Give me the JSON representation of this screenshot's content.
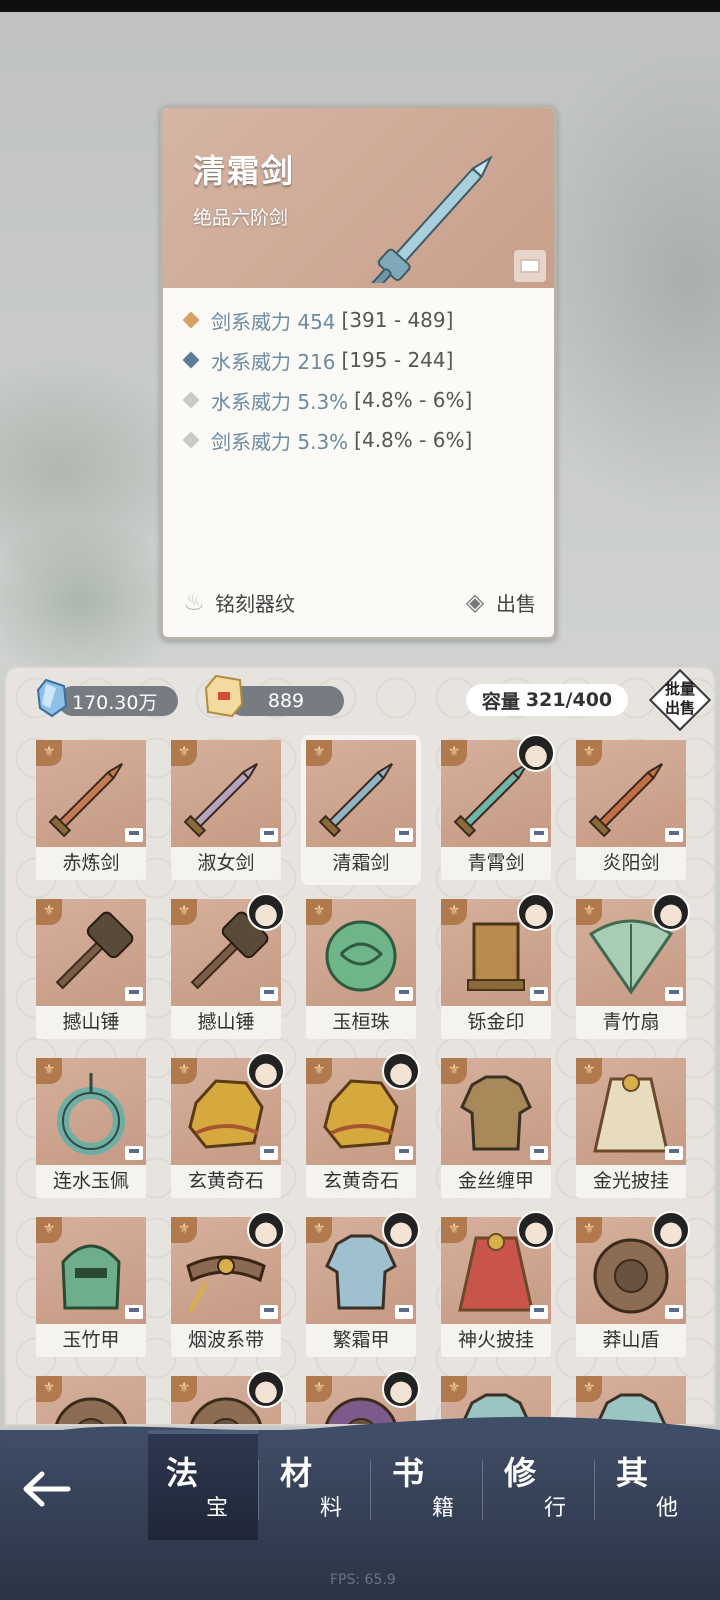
{
  "detail": {
    "name": "清霜剑",
    "grade": "绝品六阶剑",
    "stats": [
      {
        "label": "剑系威力 454",
        "range": "[391 - 489]",
        "diamond_color": "#d9a066"
      },
      {
        "label": "水系威力 216",
        "range": "[195 - 244]",
        "diamond_color": "#5f7d9c"
      },
      {
        "label": "水系威力 5.3%",
        "range": "[4.8% - 6%]",
        "diamond_color": "#c9c9c9"
      },
      {
        "label": "剑系威力 5.3%",
        "range": "[4.8% - 6%]",
        "diamond_color": "#c9c9c9"
      }
    ],
    "engrave_label": "铭刻器纹",
    "sell_label": "出售"
  },
  "bag": {
    "spirit_stones": "170.30万",
    "gold": "889",
    "capacity_label": "容量",
    "capacity_value": "321/400",
    "batch_sell_line1": "批量",
    "batch_sell_line2": "出售",
    "items": [
      {
        "name": "赤炼剑",
        "kind": "sword",
        "color": "#c77b52",
        "avatar": false
      },
      {
        "name": "淑女剑",
        "kind": "sword",
        "color": "#b8a4c0",
        "avatar": false
      },
      {
        "name": "清霜剑",
        "kind": "sword",
        "color": "#8fb6c7",
        "avatar": false,
        "selected": true
      },
      {
        "name": "青霄剑",
        "kind": "sword",
        "color": "#6fb5a8",
        "avatar": true
      },
      {
        "name": "炎阳剑",
        "kind": "sword",
        "color": "#c56f45",
        "avatar": false
      },
      {
        "name": "撼山锤",
        "kind": "hammer",
        "color": "#7a5d44",
        "avatar": false
      },
      {
        "name": "撼山锤",
        "kind": "hammer",
        "color": "#7a5d44",
        "avatar": true
      },
      {
        "name": "玉桓珠",
        "kind": "orb",
        "color": "#6fb58a",
        "avatar": false
      },
      {
        "name": "铄金印",
        "kind": "seal",
        "color": "#b98a4d",
        "avatar": true
      },
      {
        "name": "青竹扇",
        "kind": "fan",
        "color": "#a8cdb4",
        "avatar": true
      },
      {
        "name": "连水玉佩",
        "kind": "ring",
        "color": "#6faea2",
        "avatar": false
      },
      {
        "name": "玄黄奇石",
        "kind": "rock",
        "color": "#d6a93e",
        "avatar": true
      },
      {
        "name": "玄黄奇石",
        "kind": "rock",
        "color": "#d6a93e",
        "avatar": true
      },
      {
        "name": "金丝缠甲",
        "kind": "armor",
        "color": "#a88a5a",
        "avatar": false
      },
      {
        "name": "金光披挂",
        "kind": "cape",
        "color": "#e8dcc0",
        "avatar": false
      },
      {
        "name": "玉竹甲",
        "kind": "helm",
        "color": "#6fae8a",
        "avatar": false
      },
      {
        "name": "烟波系带",
        "kind": "belt",
        "color": "#8a6a52",
        "avatar": true
      },
      {
        "name": "繁霜甲",
        "kind": "armor",
        "color": "#9fc0cf",
        "avatar": true
      },
      {
        "name": "神火披挂",
        "kind": "cape",
        "color": "#c9544a",
        "avatar": true
      },
      {
        "name": "莽山盾",
        "kind": "shield",
        "color": "#8c6c52",
        "avatar": true
      },
      {
        "name": "",
        "kind": "shield",
        "color": "#8c6c52",
        "avatar": false
      },
      {
        "name": "",
        "kind": "shield",
        "color": "#8c6c52",
        "avatar": true
      },
      {
        "name": "",
        "kind": "shield",
        "color": "#7d5a8c",
        "avatar": true
      },
      {
        "name": "",
        "kind": "armor",
        "color": "#9ac5c2",
        "avatar": false
      },
      {
        "name": "",
        "kind": "armor",
        "color": "#9ac5c2",
        "avatar": false
      }
    ]
  },
  "nav": {
    "tabs": [
      {
        "big": "法",
        "small": "宝"
      },
      {
        "big": "材",
        "small": "料"
      },
      {
        "big": "书",
        "small": "籍"
      },
      {
        "big": "修",
        "small": "行"
      },
      {
        "big": "其",
        "small": "他"
      }
    ]
  },
  "fps": "FPS: 65.9"
}
